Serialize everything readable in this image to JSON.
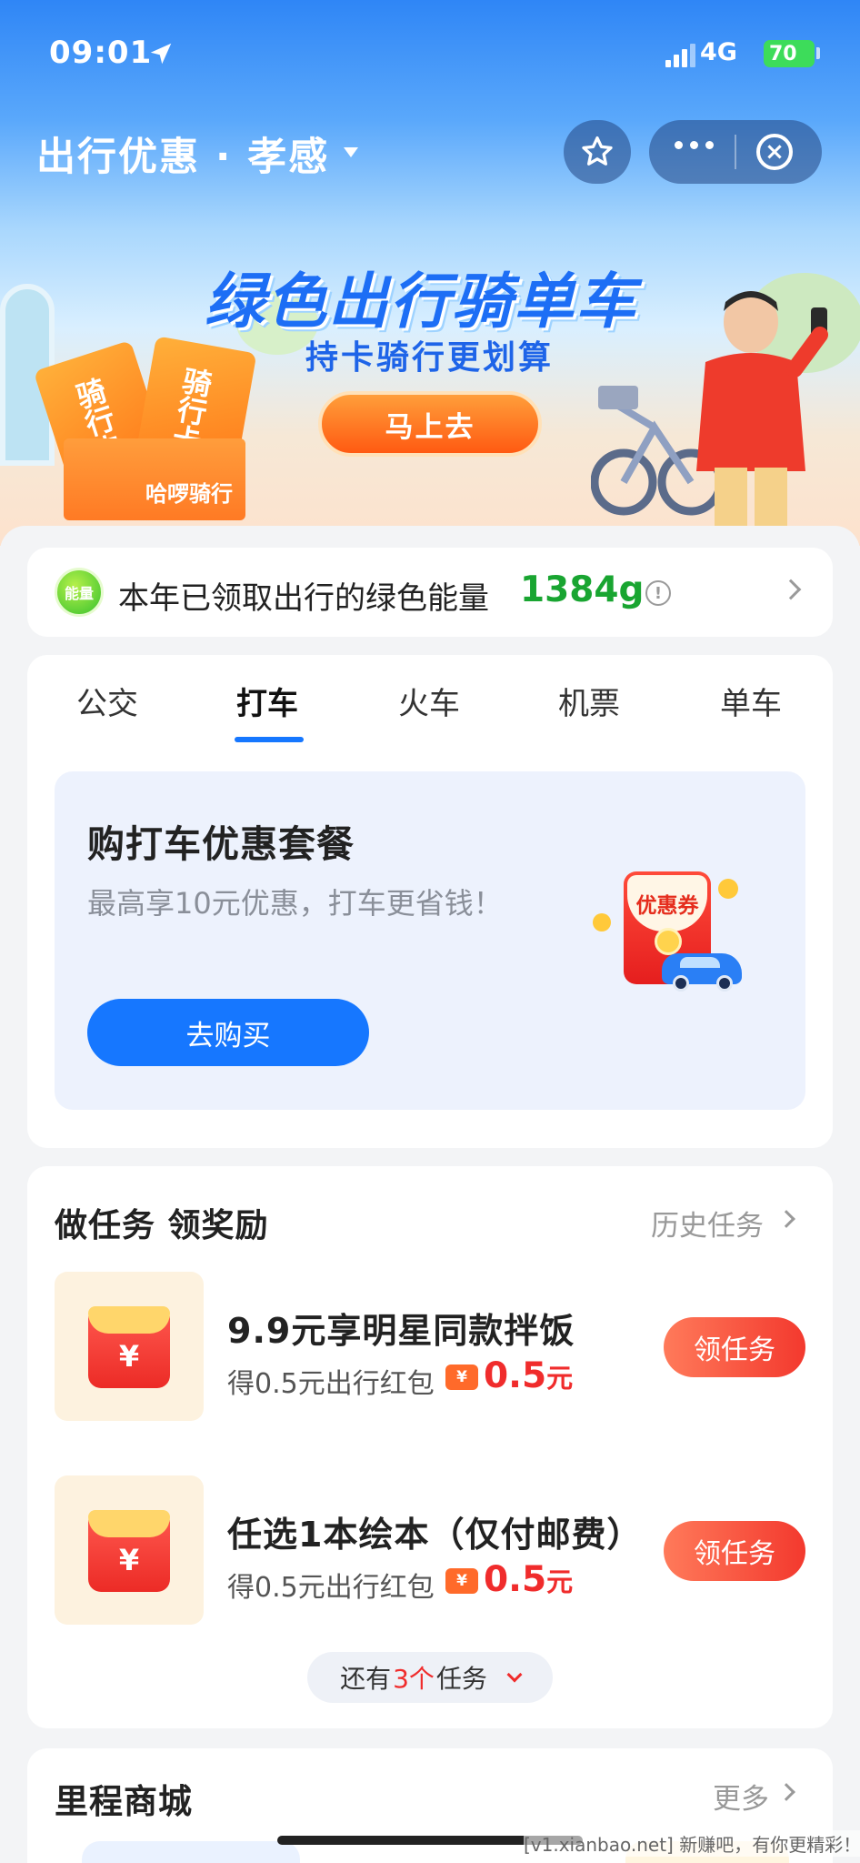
{
  "status_bar": {
    "time": "09:01",
    "network": "4G",
    "battery": "70"
  },
  "header": {
    "title": "出行优惠 · 孝感"
  },
  "banner": {
    "headline": "绿色出行骑单车",
    "subline": "持卡骑行更划算",
    "button": "马上去",
    "card_label_1": "骑行卡",
    "card_label_2": "骑行卡",
    "box_label": "哈啰骑行"
  },
  "energy": {
    "badge": "能量",
    "text": "本年已领取出行的绿色能量",
    "value": "1384g"
  },
  "tabs": [
    {
      "label": "公交"
    },
    {
      "label": "打车"
    },
    {
      "label": "火车"
    },
    {
      "label": "机票"
    },
    {
      "label": "单车"
    }
  ],
  "promo": {
    "title": "购打车优惠套餐",
    "subtitle": "最高享10元优惠，打车更省钱！",
    "button": "去购买",
    "coupon_label": "优惠券"
  },
  "tasks": {
    "heading": "做任务 领奖励",
    "history": "历史任务",
    "items": [
      {
        "title": "9.9元享明星同款拌饭",
        "desc": "得0.5元出行红包",
        "amount": "0.5",
        "unit": "元",
        "button": "领任务"
      },
      {
        "title": "任选1本绘本（仅付邮费）",
        "desc": "得0.5元出行红包",
        "amount": "0.5",
        "unit": "元",
        "button": "领任务"
      }
    ],
    "more": {
      "prefix": "还有",
      "count": "3个",
      "suffix": "任务"
    }
  },
  "mall": {
    "title": "里程商城",
    "more": "更多"
  },
  "watermark": "[v1.xianbao.net] 新赚吧，有你更精彩！",
  "colors": {
    "primary": "#1677ff",
    "energy_green": "#19a531",
    "red": "#f02c2c"
  }
}
